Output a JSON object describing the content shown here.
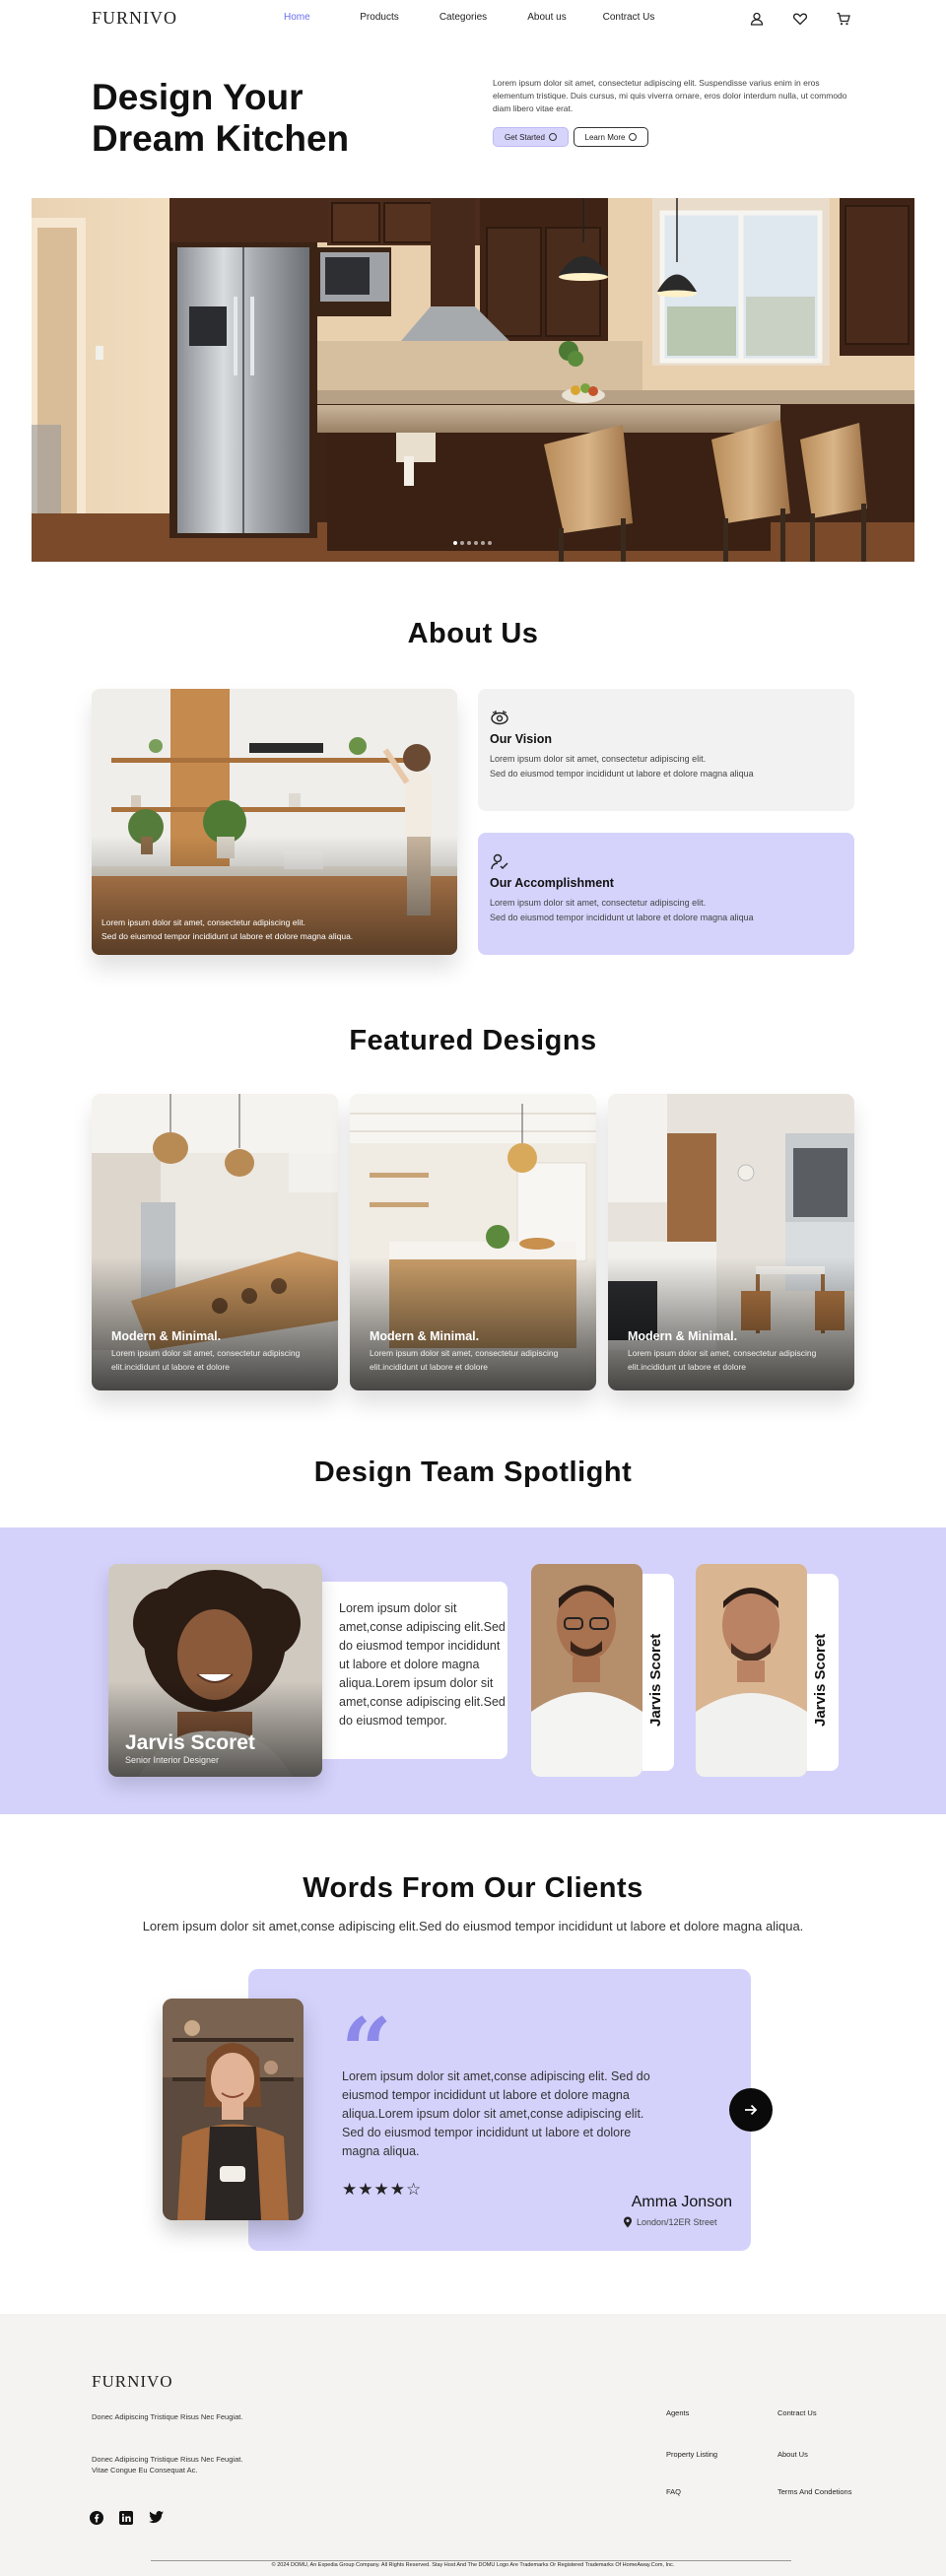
{
  "brand": "FURNIVO",
  "nav": {
    "links": [
      "Home",
      "Products",
      "Categories",
      "About us",
      "Contract Us"
    ],
    "active": "Home",
    "icons": [
      "user-icon",
      "heart-icon",
      "cart-icon"
    ]
  },
  "hero": {
    "title_line1": "Design Your",
    "title_line2": "Dream Kitchen",
    "description": "Lorem ipsum dolor sit amet, consectetur adipiscing elit. Suspendisse varius enim in eros elementum tristique. Duis cursus, mi quis viverra ornare, eros dolor interdum nulla, ut commodo diam libero vitae erat.",
    "primary_button": "Get Started",
    "secondary_button": "Learn More",
    "carousel_total": 6,
    "carousel_active": 1
  },
  "about": {
    "title": "About Us",
    "image_caption_line1": "Lorem ipsum dolor sit amet, consectetur adipiscing elit.",
    "image_caption_line2": "Sed do eiusmod tempor incididunt ut labore et dolore magna aliqua.",
    "cards": [
      {
        "title": "Our Vision",
        "line1": "Lorem ipsum dolor sit amet, consectetur adipiscing elit.",
        "line2": "Sed do eiusmod tempor incididunt ut labore et dolore magna aliqua",
        "icon": "vision-icon"
      },
      {
        "title": "Our Accomplishment",
        "line1": "Lorem ipsum dolor sit amet, consectetur adipiscing elit.",
        "line2": "Sed do eiusmod tempor incididunt ut labore et dolore magna aliqua",
        "icon": "accomplishment-icon"
      }
    ]
  },
  "featured": {
    "title": "Featured Designs",
    "cards": [
      {
        "title": "Modern & Minimal.",
        "text": "Lorem ipsum dolor sit amet, consectetur adipiscing elit.incididunt ut labore et dolore"
      },
      {
        "title": "Modern & Minimal.",
        "text": "Lorem ipsum dolor sit amet, consectetur adipiscing elit.incididunt ut labore et dolore"
      },
      {
        "title": "Modern & Minimal.",
        "text": "Lorem ipsum dolor sit amet, consectetur adipiscing elit.incididunt ut labore et dolore"
      }
    ]
  },
  "team": {
    "title": "Design Team Spotlight",
    "main": {
      "name": "Jarvis Scoret",
      "role": "Senior Interior Designer",
      "bio": "Lorem ipsum dolor sit amet,conse adipiscing elit.Sed do eiusmod tempor incididunt ut labore et dolore magna aliqua.Lorem ipsum dolor sit amet,conse adipiscing elit.Sed do eiusmod tempor."
    },
    "others": [
      {
        "name": "Jarvis Scoret"
      },
      {
        "name": "Jarvis Scoret"
      }
    ]
  },
  "testimonials": {
    "title": "Words From Our Clients",
    "subtitle": "Lorem ipsum dolor sit amet,conse adipiscing elit.Sed do eiusmod tempor incididunt ut labore et dolore magna aliqua.",
    "quote": "Lorem ipsum dolor sit amet,conse adipiscing elit. Sed do eiusmod tempor incididunt ut labore et dolore magna aliqua.Lorem ipsum dolor sit amet,conse adipiscing elit. Sed do eiusmod tempor incididunt ut labore et dolore magna aliqua.",
    "rating": 4,
    "rating_max": 5,
    "stars": "★★★★☆",
    "name": "Amma Jonson",
    "location": "London/12ER Street"
  },
  "footer": {
    "logo": "FURNIVO",
    "text1": "Donec Adipiscing Tristique Risus Nec Feugiat.",
    "text2_line1": "Donec Adipiscing Tristique Risus Nec Feugiat.",
    "text2_line2": "Vitae Congue Eu Consequat Ac.",
    "links_col1": [
      "Agents",
      "Property Listing",
      "FAQ"
    ],
    "links_col2": [
      "Contract Us",
      "About Us",
      "Terms And Condetions"
    ],
    "social": [
      "facebook-icon",
      "linkedin-icon",
      "twitter-icon"
    ],
    "copyright": "© 2024 DOMU, An Expedia Group Company. All Rights Reserved. Stay Host And The DOMU Logo Are Trademarks Or Registered Trademarks Of HomeAway.Com, Inc."
  },
  "colors": {
    "accent": "#6a6df0",
    "lavender": "#d4d2fb",
    "dark": "#0a0a0a"
  }
}
